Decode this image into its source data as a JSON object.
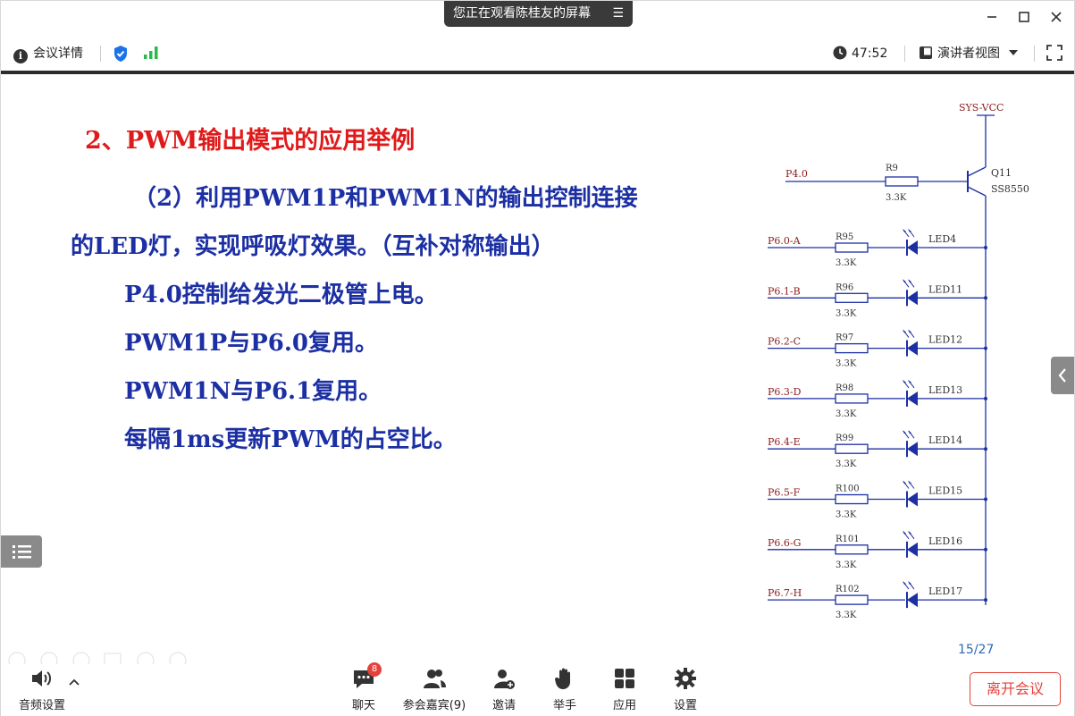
{
  "share_banner": {
    "text": "您正在观看陈桂友的屏幕"
  },
  "window_controls": {
    "minimize_icon": "minimize-icon",
    "maximize_icon": "maximize-icon",
    "close_icon": "close-icon"
  },
  "infobar": {
    "meeting_info_label": "会议详情",
    "timer": "47:52",
    "view_mode_label": "演讲者视图",
    "shield_color": "#1a73e8",
    "signal_color": "#2db84d"
  },
  "slide": {
    "title": "2、PWM输出模式的应用举例",
    "lines": [
      "（2）利用PWM1P和PWM1N的输出控制连接",
      "的LED灯，实现呼吸灯效果。（互补对称输出）",
      "P4.0控制给发光二极管上电。",
      "PWM1P与P6.0复用。",
      "PWM1N与P6.1复用。",
      "每隔1ms更新PWM的占空比。"
    ],
    "title_color": "#e01a1a",
    "text_color": "#1c2fa3",
    "page_number": "15/27",
    "circuit": {
      "supply_label": "SYS-VCC",
      "input_label": "P4.0",
      "base_resistor": {
        "name": "R9",
        "value": "3.3K"
      },
      "transistor": {
        "name": "Q11",
        "model": "SS8550"
      },
      "rows": [
        {
          "input": "P6.0-A",
          "resistor": "R95",
          "value": "3.3K",
          "led": "LED4"
        },
        {
          "input": "P6.1-B",
          "resistor": "R96",
          "value": "3.3K",
          "led": "LED11"
        },
        {
          "input": "P6.2-C",
          "resistor": "R97",
          "value": "3.3K",
          "led": "LED12"
        },
        {
          "input": "P6.3-D",
          "resistor": "R98",
          "value": "3.3K",
          "led": "LED13"
        },
        {
          "input": "P6.4-E",
          "resistor": "R99",
          "value": "3.3K",
          "led": "LED14"
        },
        {
          "input": "P6.5-F",
          "resistor": "R100",
          "value": "3.3K",
          "led": "LED15"
        },
        {
          "input": "P6.6-G",
          "resistor": "R101",
          "value": "3.3K",
          "led": "LED16"
        },
        {
          "input": "P6.7-H",
          "resistor": "R102",
          "value": "3.3K",
          "led": "LED17"
        }
      ],
      "line_color": "#1c2fa3",
      "label_color": "#8b1a1a"
    }
  },
  "toolbar": {
    "audio_label": "音频设置",
    "chat_label": "聊天",
    "chat_badge": "8",
    "participants_label": "参会嘉宾(9)",
    "invite_label": "邀请",
    "raise_hand_label": "举手",
    "apps_label": "应用",
    "settings_label": "设置",
    "leave_label": "离开会议",
    "leave_color": "#e5413a"
  }
}
